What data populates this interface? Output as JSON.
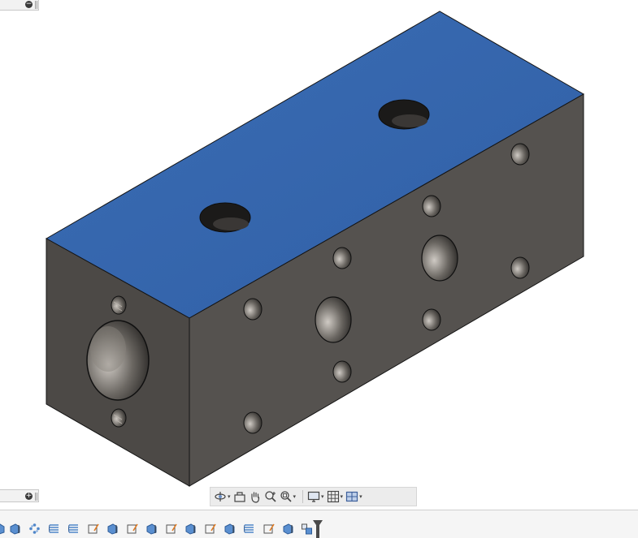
{
  "viewport": {
    "face_top_color": "#3565ad",
    "face_front_color": "#555250",
    "face_side_color": "#4a4744",
    "edge_color": "#141414"
  },
  "panels": {
    "browser_collapse_icon": "minus-circle-icon",
    "comments_expand_icon": "plus-circle-icon"
  },
  "nav_toolbar": {
    "items": [
      {
        "icon": "orbit-icon",
        "dropdown": true
      },
      {
        "icon": "look-at-icon",
        "dropdown": false
      },
      {
        "icon": "pan-icon",
        "dropdown": false
      },
      {
        "icon": "zoom-icon",
        "dropdown": false
      },
      {
        "icon": "zoom-window-icon",
        "dropdown": true
      },
      {
        "icon": "display-settings-icon",
        "dropdown": true
      },
      {
        "icon": "grid-icon",
        "dropdown": true
      },
      {
        "icon": "viewports-icon",
        "dropdown": true
      }
    ]
  },
  "timeline": {
    "features": [
      "extrude",
      "pattern",
      "thread",
      "thread",
      "sketch",
      "extrude",
      "sketch",
      "extrude",
      "sketch",
      "extrude",
      "sketch",
      "extrude",
      "thread",
      "sketch",
      "extrude",
      "multi-body"
    ],
    "marker_icon": "timeline-marker-icon"
  }
}
